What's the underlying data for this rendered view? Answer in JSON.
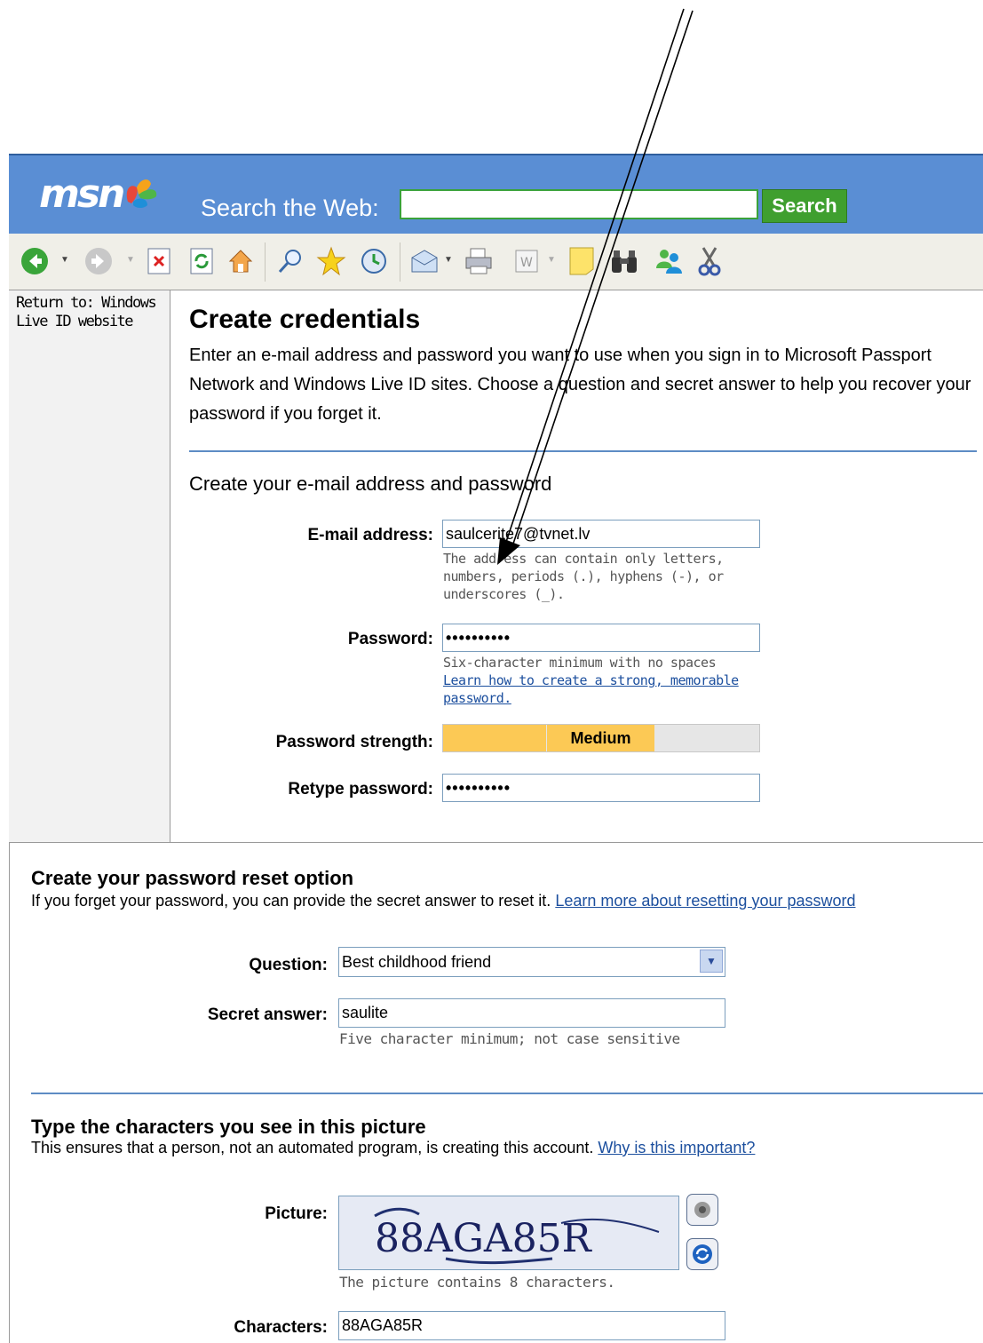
{
  "header": {
    "logo_text": "msn",
    "search_label": "Search the Web:",
    "search_value": "",
    "search_button": "Search",
    "colors": {
      "bar": "#5a8ed4",
      "search_button": "#3f9f2f"
    }
  },
  "toolbar": {
    "icons": [
      "back-icon",
      "forward-icon",
      "stop-icon",
      "refresh-icon",
      "home-icon",
      "search-icon",
      "favorites-icon",
      "history-icon",
      "mail-icon",
      "print-icon",
      "edit-icon",
      "note-icon",
      "binoculars-icon",
      "messenger-icon",
      "cut-icon"
    ]
  },
  "sidebar": {
    "return_link": "Return to: Windows Live ID website"
  },
  "main": {
    "title": "Create credentials",
    "intro": "Enter an e-mail address and password you want to use when you sign in to Microsoft Passport Network and Windows Live ID sites. Choose a question and secret answer to help you recover your password if you forget it.",
    "section1_title": "Create your e-mail address and password",
    "email_label": "E-mail address:",
    "email_value": "saulcerite7@tvnet.lv",
    "email_hint": "The address can contain only letters, numbers, periods (.), hyphens (-), or underscores (_).",
    "password_label": "Password:",
    "password_value": "••••••••••",
    "password_hint": "Six-character minimum with no spaces",
    "password_link": "Learn how to create a strong, memorable password.",
    "strength_label": "Password strength:",
    "strength_value": "Medium",
    "strength_level": "2 of 3",
    "retype_label": "Retype password:",
    "retype_value": "••••••••••"
  },
  "reset": {
    "title": "Create your password reset option",
    "desc": "If you forget your password, you can provide the secret answer to reset it.",
    "link": "Learn more about resetting your password",
    "question_label": "Question:",
    "question_value": "Best childhood friend",
    "answer_label": "Secret answer:",
    "answer_value": "saulite",
    "answer_hint": "Five character minimum; not case sensitive"
  },
  "captcha": {
    "title": "Type the characters you see in this picture",
    "desc": "This ensures that a person, not an automated program, is creating this account.",
    "link": "Why is this important?",
    "picture_label": "Picture:",
    "picture_text": "88AGA85R",
    "picture_hint": "The picture contains 8 characters.",
    "characters_label": "Characters:",
    "characters_value": "88AGA85R"
  }
}
